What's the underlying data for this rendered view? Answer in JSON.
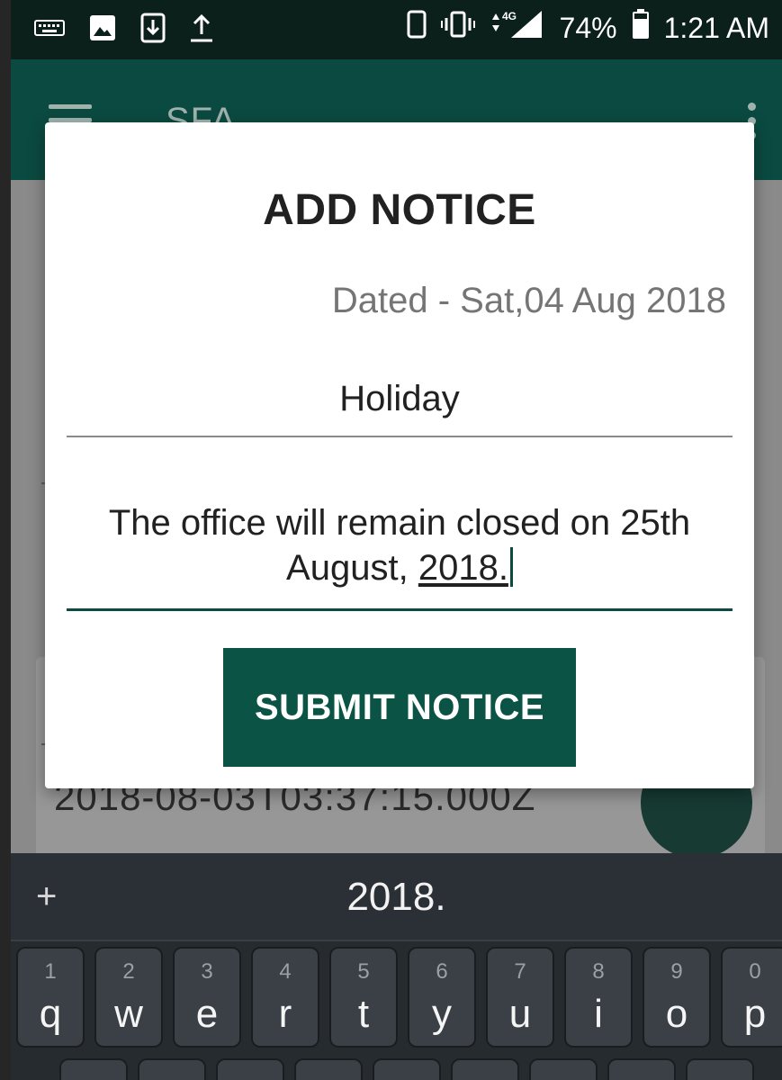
{
  "status_bar": {
    "battery": "74%",
    "time": "1:21 AM",
    "network": "4G",
    "icons_left": [
      "keyboard-icon",
      "image-icon",
      "download-icon",
      "upload-icon"
    ],
    "icons_right": [
      "phone-icon",
      "vibrate-icon",
      "data-arrows-icon",
      "signal-icon",
      "battery-icon"
    ]
  },
  "app_bar": {
    "title": "SFA",
    "menu_icon": "hamburger-menu-icon",
    "overflow_icon": "overflow-menu-icon",
    "color": "#0b4a40"
  },
  "background": {
    "timestamp": "2018-08-03T03:37:15.000Z"
  },
  "dialog": {
    "title": "ADD NOTICE",
    "date_label": "Dated - Sat,04 Aug 2018",
    "subject_value": "Holiday",
    "body_value_prefix": "The office will remain closed on 25th August,",
    "body_value_typing": "2018.",
    "submit_label": "SUBMIT NOTICE",
    "accent": "#0b5345"
  },
  "keyboard": {
    "suggestion_add": "+",
    "suggestion": "2018.",
    "top_row": [
      {
        "num": "1",
        "letter": "q"
      },
      {
        "num": "2",
        "letter": "w"
      },
      {
        "num": "3",
        "letter": "e"
      },
      {
        "num": "4",
        "letter": "r"
      },
      {
        "num": "5",
        "letter": "t"
      },
      {
        "num": "6",
        "letter": "y"
      },
      {
        "num": "7",
        "letter": "u"
      },
      {
        "num": "8",
        "letter": "i"
      },
      {
        "num": "9",
        "letter": "o"
      },
      {
        "num": "0",
        "letter": "p"
      }
    ]
  }
}
